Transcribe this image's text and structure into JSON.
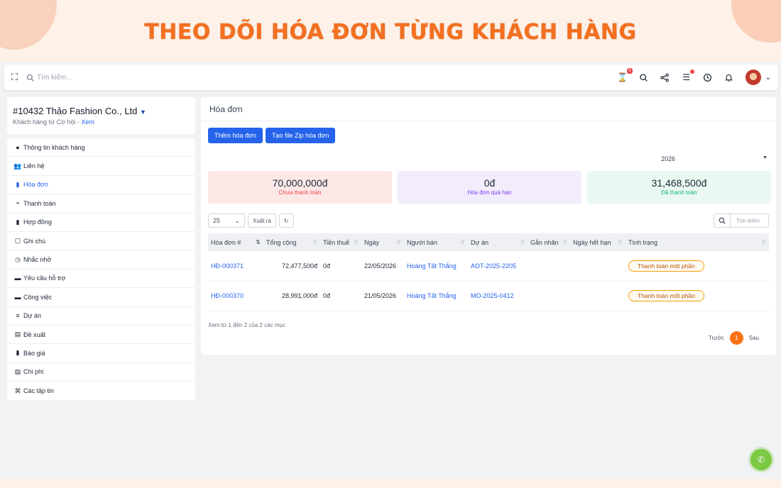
{
  "banner": {
    "title": "THEO DÕI HÓA ĐƠN TỪNG KHÁCH HÀNG"
  },
  "topbar": {
    "search_placeholder": "Tìm kiếm...",
    "timer_badge": "0"
  },
  "client": {
    "name": "#10432 Thảo Fashion Co., Ltd",
    "sub": "Khách hàng từ Cơ hội - ",
    "sub_link": "Xem"
  },
  "menu": [
    {
      "label": "Thông tin khách hàng",
      "icon": "user-circle-icon"
    },
    {
      "label": "Liên hệ",
      "icon": "users-icon"
    },
    {
      "label": "Hóa đơn",
      "icon": "file-icon",
      "active": true
    },
    {
      "label": "Thanh toán",
      "icon": "chart-line-icon"
    },
    {
      "label": "Hợp đồng",
      "icon": "file-icon"
    },
    {
      "label": "Ghi chú",
      "icon": "note-icon"
    },
    {
      "label": "Nhắc nhở",
      "icon": "clock-icon"
    },
    {
      "label": "Yêu cầu hỗ trợ",
      "icon": "ticket-icon"
    },
    {
      "label": "Công việc",
      "icon": "tasks-icon"
    },
    {
      "label": "Dự án",
      "icon": "bars-icon"
    },
    {
      "label": "Đề xuất",
      "icon": "document-icon"
    },
    {
      "label": "Báo giá",
      "icon": "copy-icon"
    },
    {
      "label": "Chi phí",
      "icon": "document-icon"
    },
    {
      "label": "Các tập tin",
      "icon": "paperclip-icon"
    }
  ],
  "main": {
    "title": "Hóa đơn",
    "add_button": "Thêm hóa đơn",
    "zip_button": "Tạo file Zip hóa đơn",
    "year": "2026",
    "stats": [
      {
        "value": "70,000,000đ",
        "label": "Chưa thanh toán"
      },
      {
        "value": "0đ",
        "label": "Hóa đơn quá hạn"
      },
      {
        "value": "31,468,500đ",
        "label": "Đã thanh toán"
      }
    ],
    "page_size": "25",
    "export": "Xuất ra",
    "search_placeholder": "Tìm kiếm",
    "columns": [
      "Hóa đơn #",
      "Tổng cộng",
      "Tiền thuế",
      "Ngày",
      "Người bán",
      "Dự án",
      "Gắn nhãn",
      "Ngày hết hạn",
      "Tình trạng"
    ],
    "rows": [
      {
        "id": "HĐ-000371",
        "total": "72,477,500đ",
        "tax": "0đ",
        "date": "22/05/2026",
        "seller": "Hoàng Tất Thắng",
        "project": "AOT-2025-2205",
        "tag": "",
        "due": "",
        "status": "Thanh toán một phần"
      },
      {
        "id": "HĐ-000370",
        "total": "28,991,000đ",
        "tax": "0đ",
        "date": "21/05/2026",
        "seller": "Hoàng Tất Thắng",
        "project": "MO-2025-0412",
        "tag": "",
        "due": "",
        "status": "Thanh toán một phần"
      }
    ],
    "footer_info": "Xem từ 1 đến 2 của 2 các mục",
    "pager": {
      "prev": "Trước",
      "current": "1",
      "next": "Sau"
    }
  },
  "colors": {
    "accent": "#f37021",
    "primary": "#2563eb",
    "call": "#7cc943"
  }
}
